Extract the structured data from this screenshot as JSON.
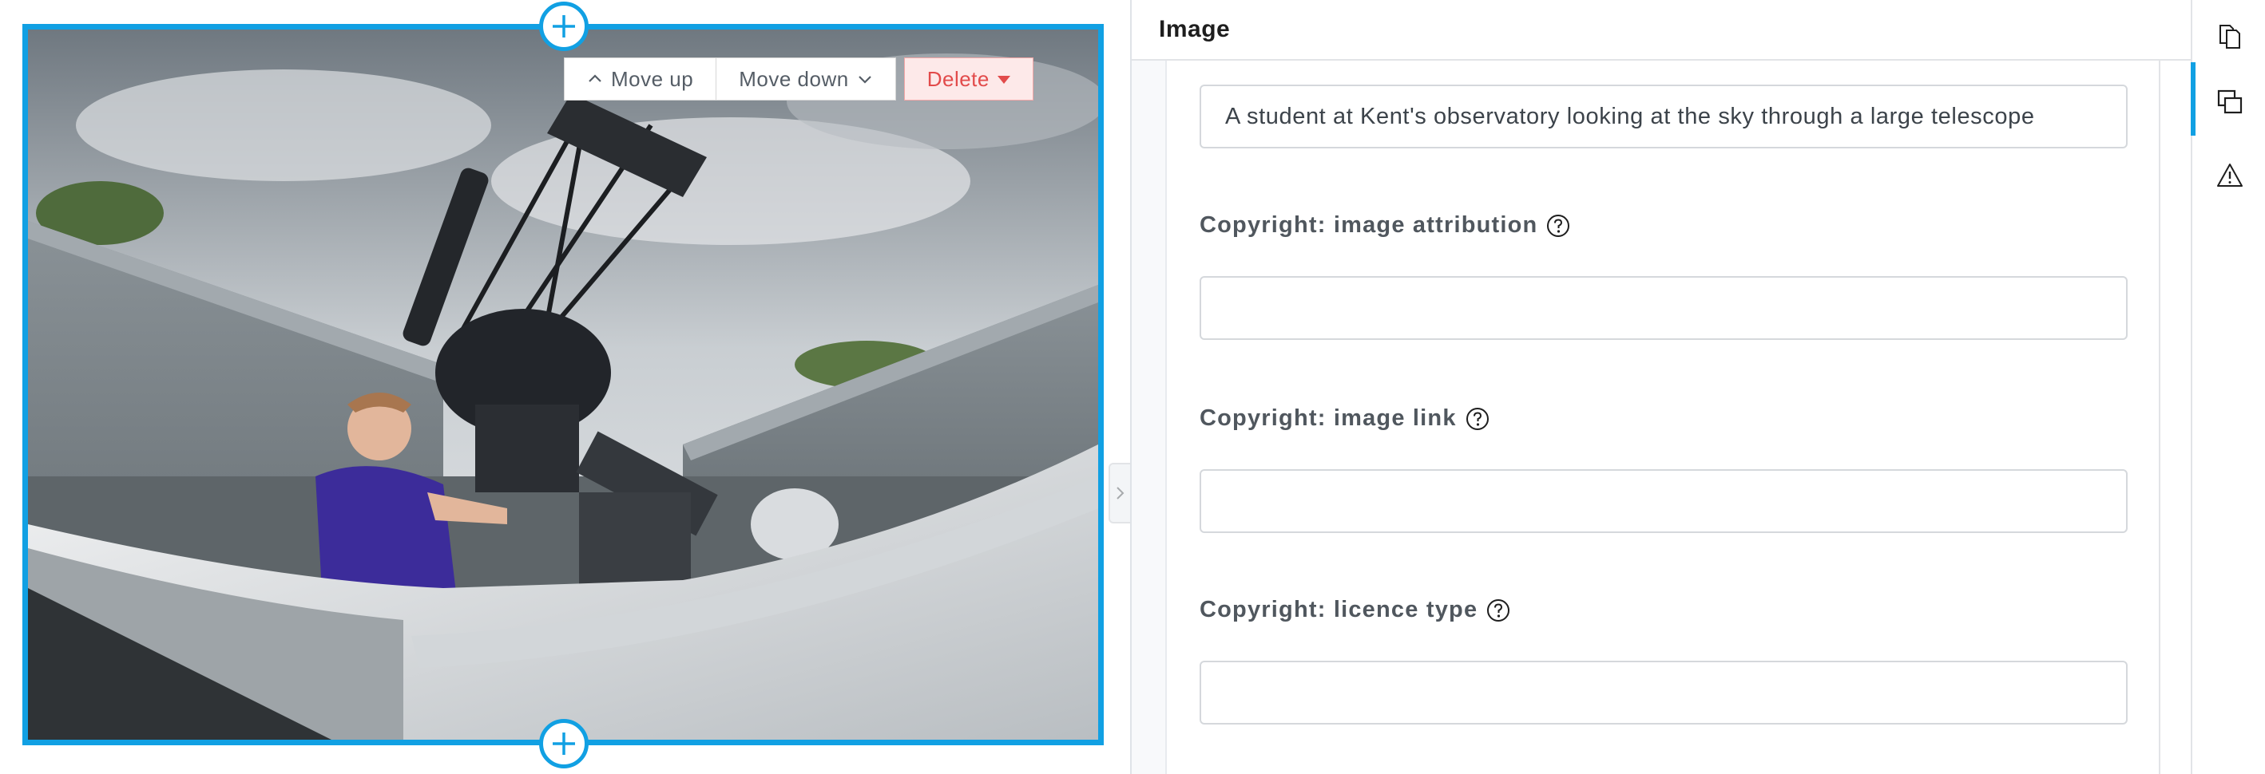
{
  "block_toolbar": {
    "move_up_label": "Move up",
    "move_down_label": "Move down",
    "delete_label": "Delete"
  },
  "image_block": {
    "icons": {
      "inserter": "plus-circle-icon",
      "move_up": "chevron-up-icon",
      "move_down": "chevron-down-icon",
      "delete_caret": "caret-down-icon"
    }
  },
  "sidebar": {
    "title": "Image",
    "fields": [
      {
        "label": "",
        "value": "A student at Kent's observatory looking at the sky through a large telescope",
        "placeholder": ""
      },
      {
        "label": "Copyright: image attribution",
        "value": "",
        "placeholder": "",
        "help_icon": "help-question-icon"
      },
      {
        "label": "Copyright: image link",
        "value": "",
        "placeholder": "",
        "help_icon": "help-question-icon"
      },
      {
        "label": "Copyright: licence type",
        "value": "",
        "placeholder": "",
        "help_icon": "help-question-icon"
      }
    ]
  },
  "rail": {
    "items": [
      {
        "icon": "pages-icon",
        "active": false
      },
      {
        "icon": "layers-icon",
        "active": true
      },
      {
        "icon": "warning-icon",
        "active": false
      }
    ]
  },
  "colors": {
    "accent": "#11a0e3",
    "delete_bg": "#fde9e9",
    "delete_text": "#e24b4b"
  }
}
